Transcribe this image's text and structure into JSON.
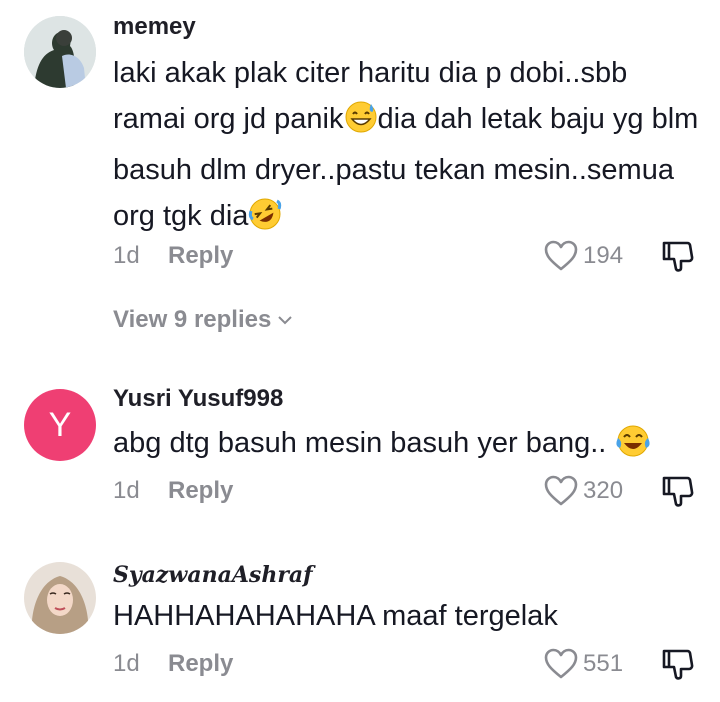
{
  "comments": [
    {
      "username": "memey",
      "text_parts": [
        "laki akak plak citer haritu dia p dobi..sbb ramai org jd panik",
        "dia dah letak baju yg blm basuh dlm dryer..pastu tekan mesin..semua org tgk dia",
        ""
      ],
      "emojis": [
        "grinning-sweat-emoji",
        "rolling-laughing-emoji"
      ],
      "time": "1d",
      "reply_label": "Reply",
      "likes": "194",
      "view_replies": "View 9 replies"
    },
    {
      "username": "Yusri Yusuf998",
      "avatar_letter": "Y",
      "avatar_color": "#ef3f73",
      "text": "abg dtg basuh mesin basuh yer bang.. ",
      "emojis": [
        "tears-of-joy-emoji"
      ],
      "time": "1d",
      "reply_label": "Reply",
      "likes": "320"
    },
    {
      "username": "SyazwanaAshraf",
      "text": "HAHHAHAHAHAHA maaf tergelak",
      "time": "1d",
      "reply_label": "Reply",
      "likes": "551"
    }
  ],
  "colors": {
    "text": "#161823",
    "muted": "#8a8b91",
    "accent_avatar": "#ef3f73"
  }
}
